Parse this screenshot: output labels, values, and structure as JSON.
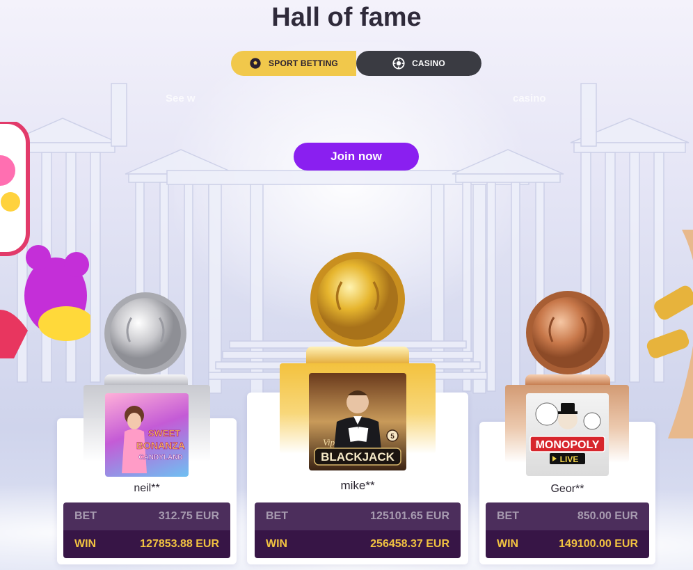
{
  "page": {
    "title": "Hall of fame",
    "subtitle_partial_left": "See w",
    "subtitle_partial_right": "casino",
    "join_label": "Join now"
  },
  "toggle": {
    "sport_label": "SPORT BETTING",
    "casino_label": "CASINO",
    "active": "casino",
    "sport_icon": "soccer-ball-icon",
    "casino_icon": "roulette-chip-icon"
  },
  "colors": {
    "accent_purple": "#8a1ff0",
    "toggle_yellow": "#f1c84b",
    "toggle_dark": "#3a3b42",
    "bet_row": "#4c2e5c",
    "win_row": "#371546",
    "win_text": "#f2c341"
  },
  "winners": [
    {
      "place": "silver",
      "player": "neil**",
      "game": "Sweet Bonanza Candyland",
      "game_lines": [
        "SWEET",
        "BONANZA",
        "CANDYLAND"
      ],
      "bet_label": "BET",
      "bet": "312.75 EUR",
      "win_label": "WIN",
      "win": "127853.88 EUR"
    },
    {
      "place": "gold",
      "player": "mike**",
      "game": "VIP Blackjack 5",
      "game_lines": [
        "Vip",
        "BLACKJACK",
        "5"
      ],
      "bet_label": "BET",
      "bet": "125101.65 EUR",
      "win_label": "WIN",
      "win": "256458.37 EUR"
    },
    {
      "place": "bronze",
      "player": "Geor**",
      "game": "Monopoly Live",
      "game_lines": [
        "MONOPOLY",
        "LIVE"
      ],
      "bet_label": "BET",
      "bet": "850.00 EUR",
      "win_label": "WIN",
      "win": "149100.00 EUR"
    }
  ]
}
